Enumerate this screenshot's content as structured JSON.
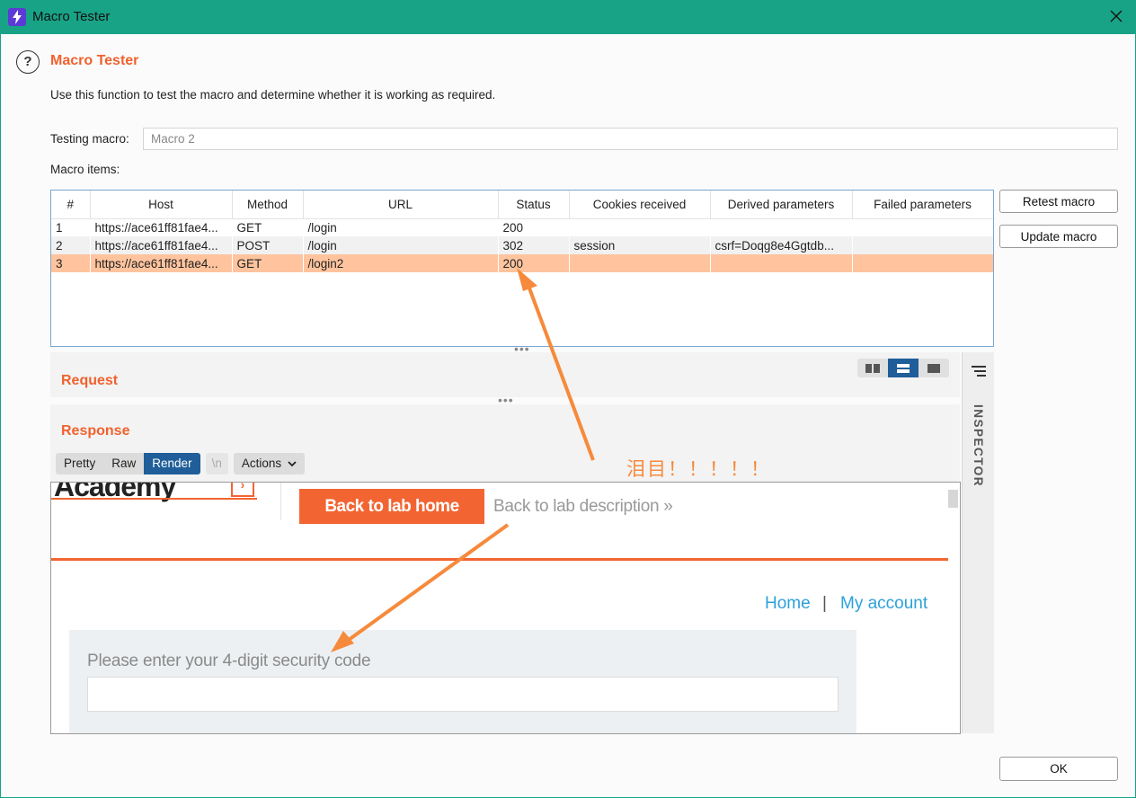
{
  "window": {
    "title": "Macro Tester"
  },
  "header": {
    "title": "Macro Tester",
    "description": "Use this function to test the macro and determine whether it is working as required."
  },
  "testing_macro": {
    "label": "Testing macro:",
    "value": "Macro 2"
  },
  "macro_items": {
    "label": "Macro items:",
    "columns": [
      "#",
      "Host",
      "Method",
      "URL",
      "Status",
      "Cookies received",
      "Derived parameters",
      "Failed parameters"
    ],
    "rows": [
      {
        "num": "1",
        "host": "https://ace61ff81fae4...",
        "method": "GET",
        "url": "/login",
        "status": "200",
        "cookies": "",
        "derived": "",
        "failed": ""
      },
      {
        "num": "2",
        "host": "https://ace61ff81fae4...",
        "method": "POST",
        "url": "/login",
        "status": "302",
        "cookies": "session",
        "derived": "csrf=Doqg8e4Ggtdb...",
        "failed": ""
      },
      {
        "num": "3",
        "host": "https://ace61ff81fae4...",
        "method": "GET",
        "url": "/login2",
        "status": "200",
        "cookies": "",
        "derived": "",
        "failed": ""
      }
    ],
    "selected_row": 3
  },
  "buttons": {
    "retest": "Retest macro",
    "update": "Update macro",
    "ok": "OK"
  },
  "request": {
    "title": "Request"
  },
  "response": {
    "title": "Response",
    "view_tabs": {
      "pretty": "Pretty",
      "raw": "Raw",
      "render": "Render",
      "newline": "\\n",
      "actions": "Actions"
    },
    "active_tab": "Render"
  },
  "inspector": {
    "label": "INSPECTOR"
  },
  "rendered_page": {
    "logo_text": "Academy",
    "lab_home": "Back to lab home",
    "lab_description": "Back to lab description",
    "nav_home": "Home",
    "nav_separator": "|",
    "nav_account": "My account",
    "form_label": "Please enter your 4-digit security code"
  },
  "annotation": {
    "text": "泪目！！！！！"
  },
  "colors": {
    "titlebar": "#18a386",
    "accent_orange": "#f0622d",
    "selected_row": "#ffc49e",
    "active_tab": "#1f5e99",
    "link_blue": "#2da1d9",
    "annotation_arrow": "#f68a3c"
  }
}
